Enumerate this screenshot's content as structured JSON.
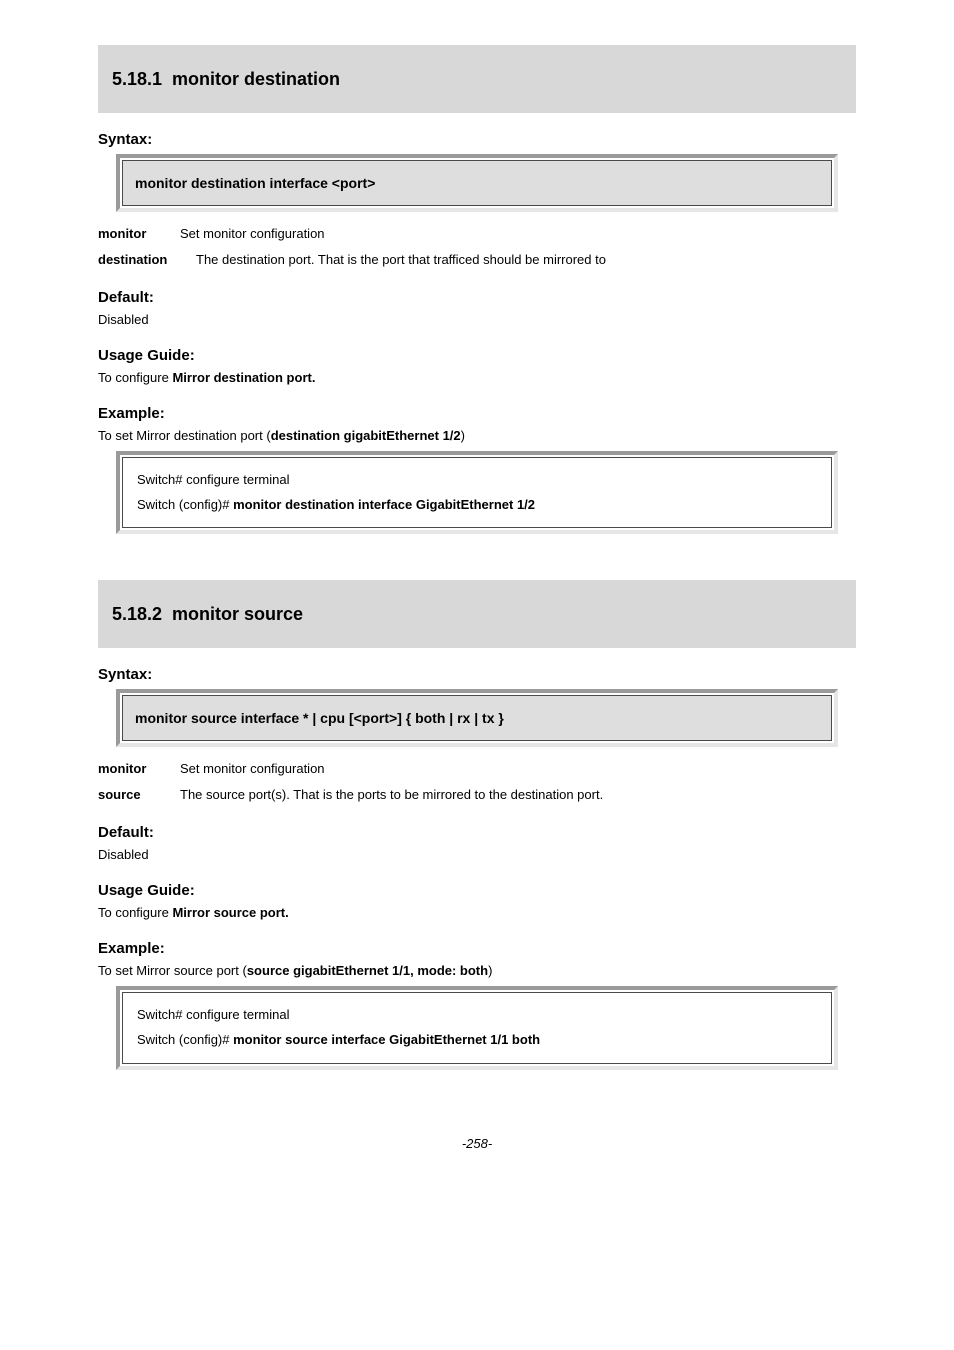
{
  "sections": [
    {
      "banner_number": "5.18.1",
      "banner_title": "monitor destination",
      "syntax_label": "Syntax:",
      "syntax_text": "monitor destination interface <port>",
      "param_rows": [
        {
          "key": "monitor",
          "val": "Set monitor configuration"
        },
        {
          "key": "destination",
          "val": "The destination port. That is the port that trafficed should be mirrored to"
        }
      ],
      "default_label": "Default:",
      "default_val": "Disabled",
      "usage_label": "Usage Guide:",
      "usage_val": "To configure Mirror destination port.",
      "example_label": "Example:",
      "example_lead": "To set Mirror destination port (",
      "example_cmd": "destination gigabitEthernet 1/2",
      "example_tail": ")",
      "code": {
        "line1_a": "Switch# configure terminal",
        "line2_a": "Switch (config)# ",
        "line2_b": "monitor destination interface GigabitEthernet 1/2"
      }
    },
    {
      "banner_number": "5.18.2",
      "banner_title": "monitor source",
      "syntax_label": "Syntax:",
      "syntax_text": "monitor source interface * | cpu [<port>] { both | rx | tx }",
      "param_rows": [
        {
          "key": "monitor",
          "val": "Set monitor configuration"
        },
        {
          "key": "source",
          "val": "The source port(s). That is the ports to be mirrored to the destination port."
        }
      ],
      "default_label": "Default:",
      "default_val": "Disabled",
      "usage_label": "Usage Guide:",
      "usage_val": "To configure Mirror source port.",
      "example_label": "Example:",
      "example_lead": "To set Mirror source port (",
      "example_cmd": "source gigabitEthernet 1/1, mode: both",
      "example_tail": ")",
      "code": {
        "line1_a": "Switch# configure terminal",
        "line2_a": "Switch (config)# ",
        "line2_b": "monitor source interface GigabitEthernet 1/1 both"
      }
    }
  ],
  "footer": "-258-"
}
